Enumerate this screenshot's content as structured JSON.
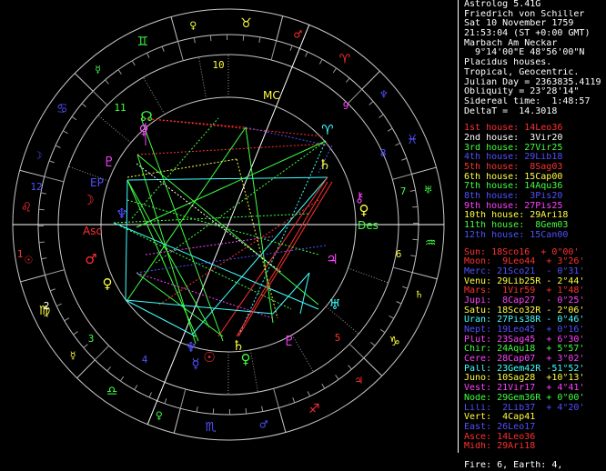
{
  "header": [
    "Astrolog 5.41G",
    "Friedrich von Schiller",
    "Sat 10 November 1759",
    "21:53:04 (ST +0:00 GMT)",
    "Marbach Am Neckar",
    "  9°14'00\"E 48°56'00\"N",
    "Placidus houses.",
    "Tropical, Geocentric.",
    "Julian Day = 2363835.4119",
    "Obliquity = 23°28'14\"",
    "Sidereal time:  1:48:57",
    "DeltaT =  14.3018"
  ],
  "houses": [
    {
      "text": "1st house: 14Leo36",
      "color": "#ff3030"
    },
    {
      "text": "2nd house:  3Vir20",
      "color": "#ffffff"
    },
    {
      "text": "3rd house: 27Vir25",
      "color": "#40ff40"
    },
    {
      "text": "4th house: 29Lib18",
      "color": "#5050ff"
    },
    {
      "text": "5th house:  8Sag03",
      "color": "#ff3030"
    },
    {
      "text": "6th house: 15Cap00",
      "color": "#ffff40"
    },
    {
      "text": "7th house: 14Aqu36",
      "color": "#40ff40"
    },
    {
      "text": "8th house:  3Pis20",
      "color": "#5050ff"
    },
    {
      "text": "9th house: 27Pis25",
      "color": "#ff40ff"
    },
    {
      "text": "10th house: 29Ari18",
      "color": "#ffff40"
    },
    {
      "text": "11th house:  8Gem03",
      "color": "#40ff40"
    },
    {
      "text": "12th house: 15Can00",
      "color": "#5050ff"
    }
  ],
  "planets": [
    {
      "text": "Sun: 18Sco16  + 0°00'",
      "color": "#ff3030"
    },
    {
      "text": "Moon:  9Leo44  + 3°26'",
      "color": "#ff3030"
    },
    {
      "text": "Merc: 21Sco21  - 0°31'",
      "color": "#5050ff"
    },
    {
      "text": "Venu: 29Lib25R - 2°44'",
      "color": "#ffff40"
    },
    {
      "text": "Mars:  1Vir59  + 1°48'",
      "color": "#ff3030"
    },
    {
      "text": "Jupi:  8Cap27  - 0°25'",
      "color": "#ff40ff"
    },
    {
      "text": "Satu: 18Sco32R - 2°06'",
      "color": "#ffff40"
    },
    {
      "text": "Uran: 27Pis38R - 0°46'",
      "color": "#40ffff"
    },
    {
      "text": "Nept: 19Leo45  + 0°16'",
      "color": "#5050ff"
    },
    {
      "text": "Plut: 23Sag45  + 6°30'",
      "color": "#ff40ff"
    },
    {
      "text": "Chir: 24Aqu18  + 5°57'",
      "color": "#40ff40"
    },
    {
      "text": "Cere: 28Cap07  + 3°02'",
      "color": "#ff40ff"
    },
    {
      "text": "Pall: 23Gem42R -51°52'",
      "color": "#40ffff"
    },
    {
      "text": "Juno: 10Sag28  +10°13'",
      "color": "#ffff40"
    },
    {
      "text": "Vest: 21Vir17  + 4°41'",
      "color": "#ff40ff"
    },
    {
      "text": "Node: 29Gem36R + 0°00'",
      "color": "#40ff40"
    },
    {
      "text": "Lili:  2Lib37  + 4°20'",
      "color": "#5050ff"
    },
    {
      "text": "Vert:  4Cap41",
      "color": "#ffff40"
    },
    {
      "text": "East: 26Leo17",
      "color": "#5050ff"
    },
    {
      "text": "Asce: 14Leo36",
      "color": "#ff3030"
    },
    {
      "text": "Midh: 29Ari18",
      "color": "#ff3030"
    }
  ],
  "footer": "Fire: 6, Earth: 4,",
  "wheel": {
    "house_numbers": [
      "1",
      "2",
      "3",
      "4",
      "5",
      "6",
      "7",
      "8",
      "9",
      "10",
      "11",
      "12"
    ],
    "angle_labels": {
      "asc": "Asc",
      "des": "Des",
      "mc": "MC",
      "ep": "EP"
    }
  }
}
